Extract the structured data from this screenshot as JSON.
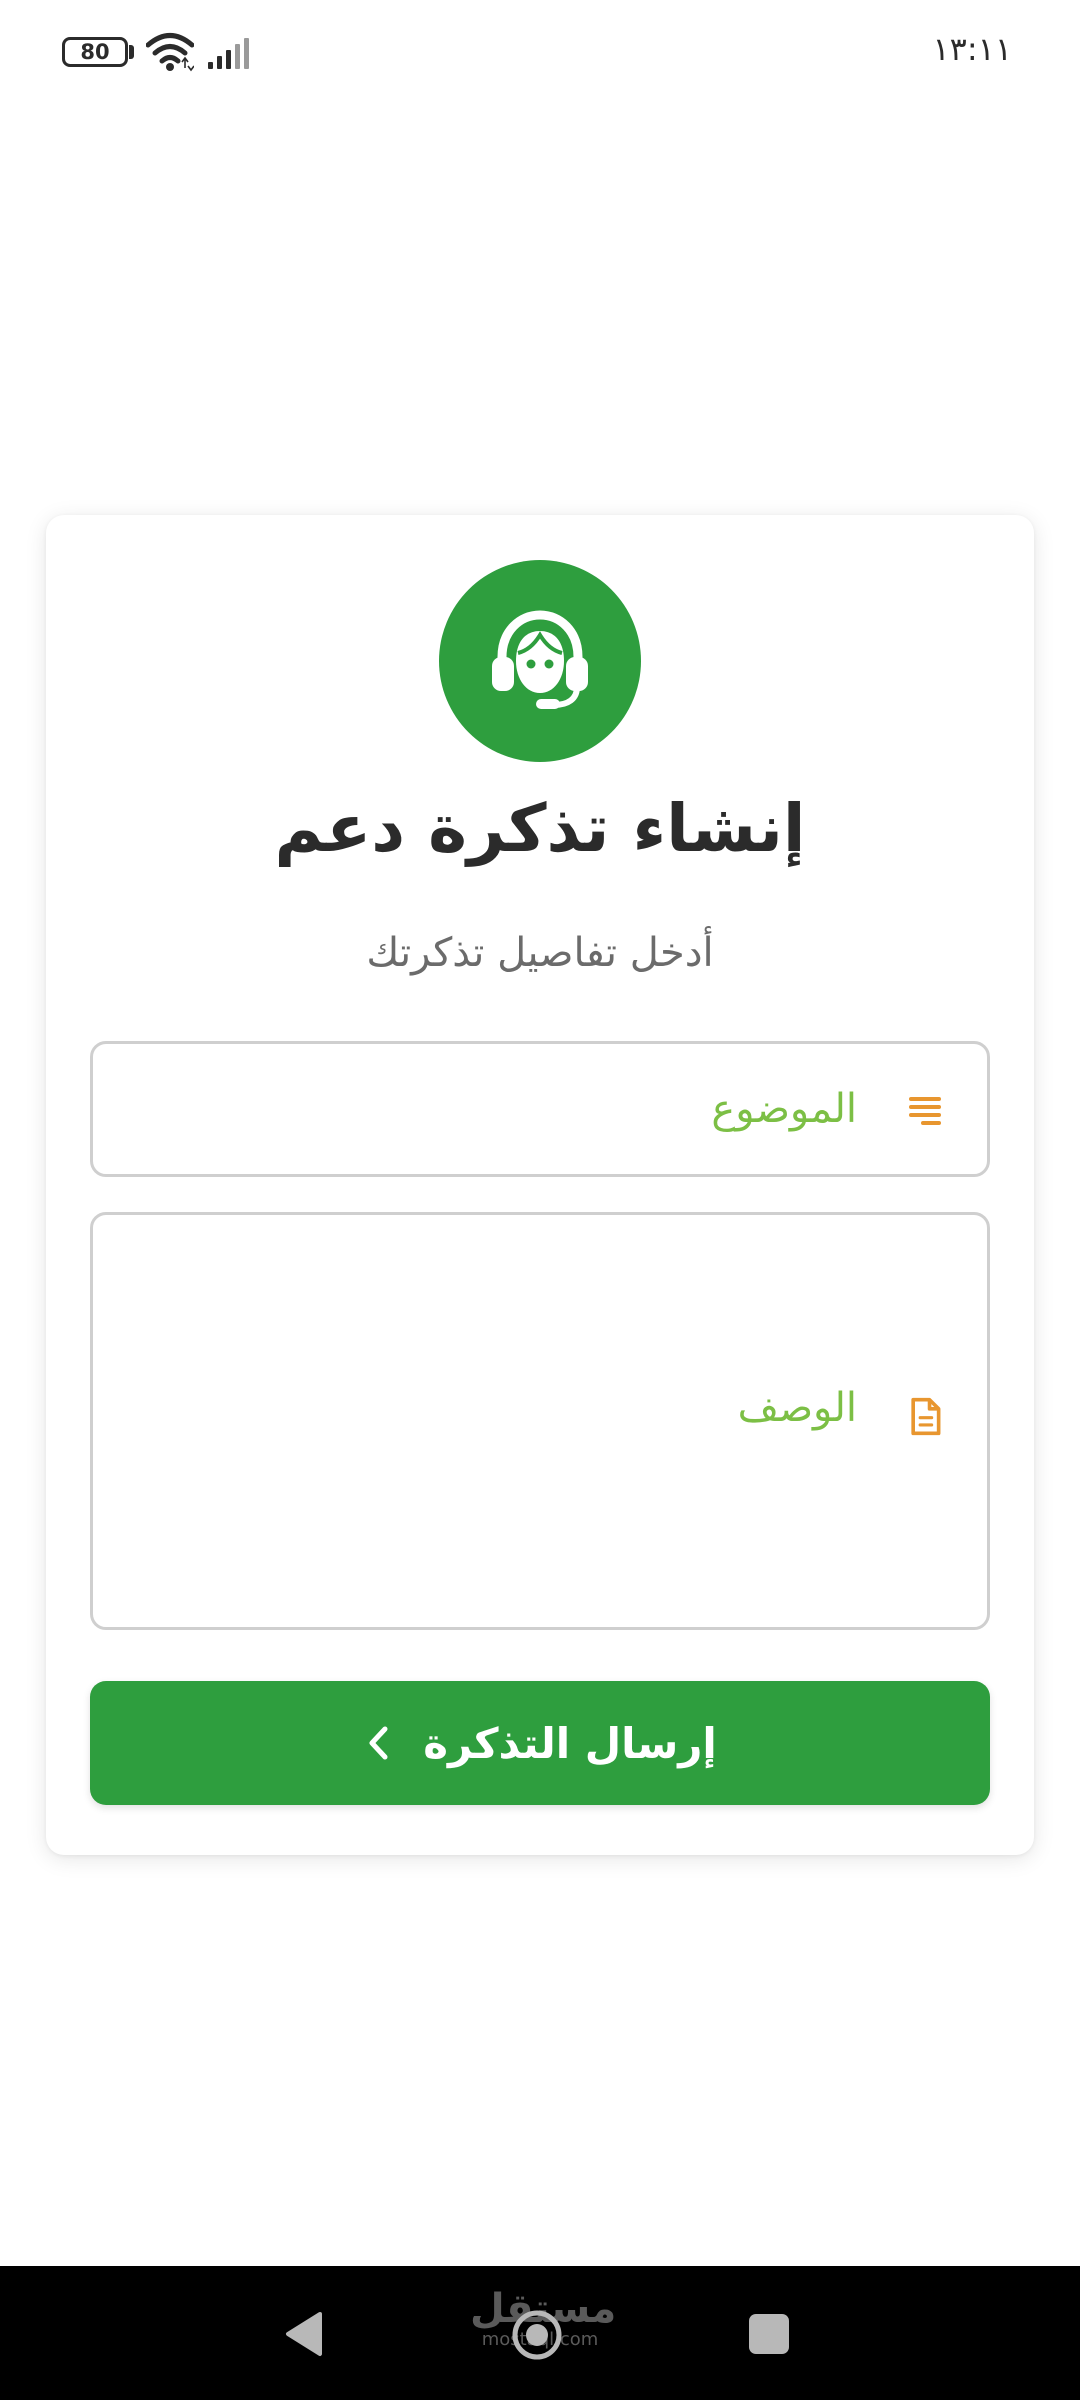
{
  "status_bar": {
    "battery_level": "80",
    "time": "١٣:١١",
    "icons": [
      "battery-icon",
      "wifi-icon",
      "signal-icon"
    ]
  },
  "card": {
    "icon": "support-agent-icon",
    "title": "إنشاء تذكرة دعم",
    "subtitle": "أدخل تفاصيل تذكرتك"
  },
  "form": {
    "subject_placeholder": "الموضوع",
    "subject_value": "",
    "subject_icon": "list-lines-icon",
    "description_placeholder": "الوصف",
    "description_value": "",
    "description_icon": "document-icon",
    "submit_label": "إرسال التذكرة",
    "submit_icon": "chevron-left-icon"
  },
  "colors": {
    "primary_green": "#2e9e3e",
    "placeholder_green": "#7cbf45",
    "icon_orange": "#e8962f"
  },
  "watermark": {
    "main": "مستقل",
    "sub": "mostaql.com"
  }
}
